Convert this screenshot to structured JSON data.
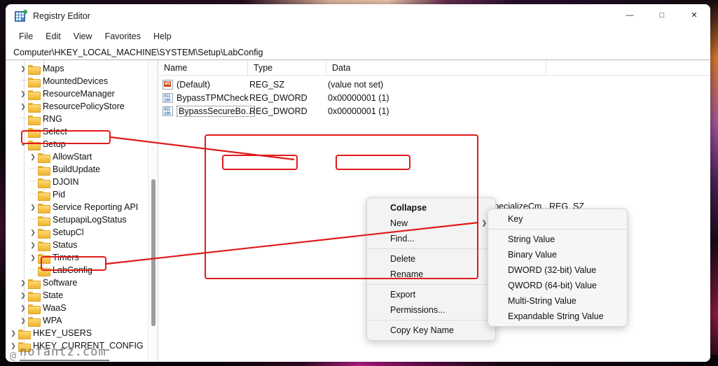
{
  "window": {
    "title": "Registry Editor",
    "icon": "registry-editor-icon",
    "controls": {
      "minimize": "—",
      "maximize": "□",
      "close": "✕"
    }
  },
  "menu_bar": {
    "items": [
      "File",
      "Edit",
      "View",
      "Favorites",
      "Help"
    ]
  },
  "address_bar": {
    "path": "Computer\\HKEY_LOCAL_MACHINE\\SYSTEM\\Setup\\LabConfig"
  },
  "tree": {
    "rows": [
      {
        "label": "Maps",
        "indent": 2,
        "chevron": "collapsed",
        "highlight": false
      },
      {
        "label": "MountedDevices",
        "indent": 2,
        "chevron": "none",
        "highlight": false
      },
      {
        "label": "ResourceManager",
        "indent": 2,
        "chevron": "collapsed",
        "highlight": false
      },
      {
        "label": "ResourcePolicyStore",
        "indent": 2,
        "chevron": "collapsed",
        "highlight": false
      },
      {
        "label": "RNG",
        "indent": 2,
        "chevron": "none",
        "highlight": false
      },
      {
        "label": "Select",
        "indent": 2,
        "chevron": "none",
        "highlight": false
      },
      {
        "label": "Setup",
        "indent": 2,
        "chevron": "expanded",
        "highlight": true
      },
      {
        "label": "AllowStart",
        "indent": 3,
        "chevron": "collapsed",
        "highlight": false
      },
      {
        "label": "BuildUpdate",
        "indent": 3,
        "chevron": "none",
        "highlight": false
      },
      {
        "label": "DJOIN",
        "indent": 3,
        "chevron": "none",
        "highlight": false
      },
      {
        "label": "Pid",
        "indent": 3,
        "chevron": "none",
        "highlight": false
      },
      {
        "label": "Service Reporting API",
        "indent": 3,
        "chevron": "collapsed",
        "highlight": false
      },
      {
        "label": "SetupapiLogStatus",
        "indent": 3,
        "chevron": "none",
        "highlight": false
      },
      {
        "label": "SetupCl",
        "indent": 3,
        "chevron": "collapsed",
        "highlight": false
      },
      {
        "label": "Status",
        "indent": 3,
        "chevron": "collapsed",
        "highlight": false
      },
      {
        "label": "Timers",
        "indent": 3,
        "chevron": "collapsed",
        "highlight": false
      },
      {
        "label": "LabConfig",
        "indent": 3,
        "chevron": "none",
        "highlight": true
      },
      {
        "label": "Software",
        "indent": 2,
        "chevron": "collapsed",
        "highlight": false
      },
      {
        "label": "State",
        "indent": 2,
        "chevron": "collapsed",
        "highlight": false
      },
      {
        "label": "WaaS",
        "indent": 2,
        "chevron": "collapsed",
        "highlight": false
      },
      {
        "label": "WPA",
        "indent": 2,
        "chevron": "collapsed",
        "highlight": false
      },
      {
        "label": "HKEY_USERS",
        "indent": 1,
        "chevron": "collapsed",
        "highlight": false
      },
      {
        "label": "HKEY_CURRENT_CONFIG",
        "indent": 1,
        "chevron": "collapsed",
        "highlight": false
      }
    ],
    "chevron_glyphs": {
      "collapsed": "❯",
      "expanded": "⌄"
    }
  },
  "values": {
    "columns": [
      "Name",
      "Type",
      "Data"
    ],
    "rows": [
      {
        "icon": "string-value-icon",
        "name": "(Default)",
        "type": "REG_SZ",
        "data": "(value not set)",
        "focused": false
      },
      {
        "icon": "binary-value-icon",
        "name": "BypassTPMCheck",
        "type": "REG_DWORD",
        "data": "0x00000001 (1)",
        "focused": false
      },
      {
        "icon": "binary-value-icon",
        "name": "BypassSecureBo...",
        "type": "REG_DWORD",
        "data": "0x00000001 (1)",
        "focused": true
      }
    ],
    "occluded_row": {
      "name": "especializeCm...",
      "type": "REG_SZ"
    }
  },
  "context_menu": {
    "items": [
      {
        "label": "Collapse",
        "bold": true,
        "submenu": false,
        "sep_after": false
      },
      {
        "label": "New",
        "bold": false,
        "submenu": true,
        "sep_after": false
      },
      {
        "label": "Find...",
        "bold": false,
        "submenu": false,
        "sep_after": true
      },
      {
        "label": "Delete",
        "bold": false,
        "submenu": false,
        "sep_after": false
      },
      {
        "label": "Rename",
        "bold": false,
        "submenu": false,
        "sep_after": true
      },
      {
        "label": "Export",
        "bold": false,
        "submenu": false,
        "sep_after": false
      },
      {
        "label": "Permissions...",
        "bold": false,
        "submenu": false,
        "sep_after": true
      },
      {
        "label": "Copy Key Name",
        "bold": false,
        "submenu": false,
        "sep_after": false
      }
    ],
    "submenu_arrow": "❯"
  },
  "submenu": {
    "items": [
      {
        "label": "Key",
        "sep_after": true
      },
      {
        "label": "String Value",
        "sep_after": false
      },
      {
        "label": "Binary Value",
        "sep_after": false
      },
      {
        "label": "DWORD (32-bit) Value",
        "sep_after": false
      },
      {
        "label": "QWORD (64-bit) Value",
        "sep_after": false
      },
      {
        "label": "Multi-String Value",
        "sep_after": false
      },
      {
        "label": "Expandable String Value",
        "sep_after": false
      }
    ]
  },
  "annotations": {
    "accent_color": "#e01b1b",
    "boxes": [
      "setup-key",
      "labconfig-key",
      "new-menu-item",
      "key-submenu-item",
      "context-menu-region"
    ],
    "arrows": [
      "setup-to-menu",
      "labconfig-to-menu"
    ]
  },
  "watermark": {
    "at": "@",
    "text": "nofantz.com"
  }
}
